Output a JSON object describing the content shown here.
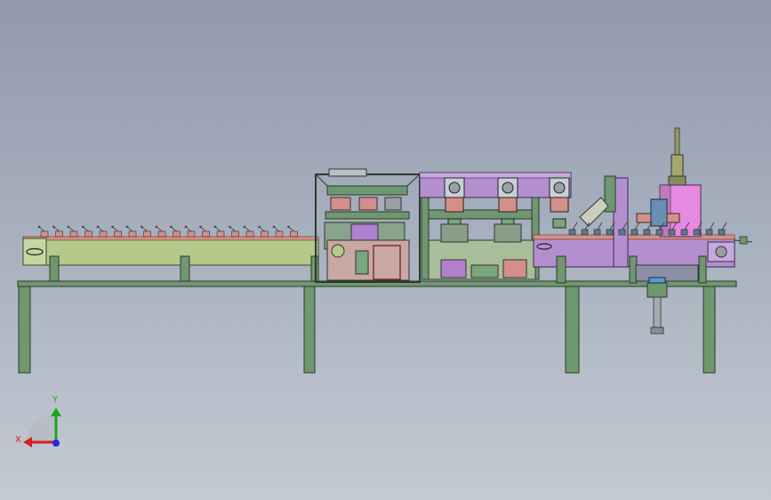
{
  "viewport": {
    "background_top": "#909aac",
    "background_bottom": "#c4cad3"
  },
  "model": {
    "description_icon": "cad-assembly",
    "colors": {
      "frame": "#6f9770",
      "conveyor": "#b5c98a",
      "module_purple": "#b48fd0",
      "module_pink": "#e58ae0",
      "cylinder_red": "#d88c86",
      "steel": "#9aa0a6"
    }
  },
  "triad": {
    "x_label": "X",
    "y_label": "Y",
    "x_color": "#d42020",
    "y_color": "#1aa81a",
    "z_color": "#2030d8"
  }
}
